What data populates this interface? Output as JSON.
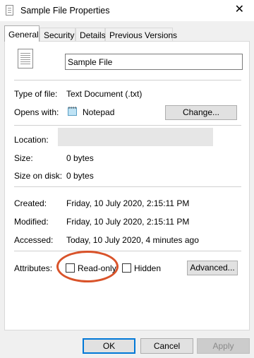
{
  "window": {
    "title": "Sample File Properties",
    "close_glyph": "✕"
  },
  "tabs": [
    {
      "label": "General",
      "active": true
    },
    {
      "label": "Security"
    },
    {
      "label": "Details"
    },
    {
      "label": "Previous Versions"
    }
  ],
  "general": {
    "file_name": "Sample File",
    "type_label": "Type of file:",
    "type_value": "Text Document (.txt)",
    "opens_label": "Opens with:",
    "opens_value": "Notepad",
    "change_button": "Change...",
    "location_label": "Location:",
    "size_label": "Size:",
    "size_value": "0 bytes",
    "size_disk_label": "Size on disk:",
    "size_disk_value": "0 bytes",
    "created_label": "Created:",
    "created_value": "Friday, 10 July 2020, 2:15:11 PM",
    "modified_label": "Modified:",
    "modified_value": "Friday, 10 July 2020, 2:15:11 PM",
    "accessed_label": "Accessed:",
    "accessed_value": "Today, 10 July 2020, 4 minutes ago",
    "attributes_label": "Attributes:",
    "readonly_label": "Read-only",
    "readonly_checked": false,
    "hidden_label": "Hidden",
    "hidden_checked": false,
    "advanced_button": "Advanced..."
  },
  "footer": {
    "ok": "OK",
    "cancel": "Cancel",
    "apply": "Apply"
  },
  "colors": {
    "highlight": "#d9532a",
    "accent": "#0078d7"
  }
}
